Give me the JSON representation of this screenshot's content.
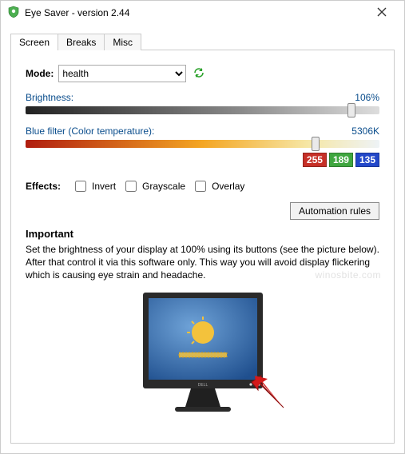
{
  "window": {
    "title": "Eye Saver - version 2.44"
  },
  "tabs": {
    "screen": "Screen",
    "breaks": "Breaks",
    "misc": "Misc"
  },
  "mode": {
    "label": "Mode:",
    "value": "health"
  },
  "brightness": {
    "label": "Brightness:",
    "value": "106%",
    "percent": 92
  },
  "bluefilter": {
    "label": "Blue filter (Color temperature):",
    "value": "5306K",
    "percent": 82
  },
  "rgb": {
    "r": "255",
    "g": "189",
    "b": "135"
  },
  "effects": {
    "label": "Effects:",
    "invert": "Invert",
    "grayscale": "Grayscale",
    "overlay": "Overlay"
  },
  "automation_button": "Automation rules",
  "important": {
    "heading": "Important",
    "text": "Set the brightness of your display at 100% using its buttons (see the picture below). After that control it via this software only. This way you will avoid display flickering which is causing eye strain and headache."
  },
  "watermark": "winosbite.com"
}
